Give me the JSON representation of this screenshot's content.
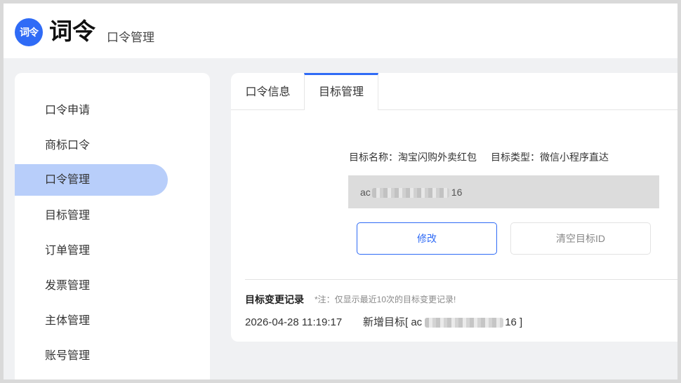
{
  "header": {
    "logo_text": "词令",
    "brand": "词令",
    "subtitle": "口令管理"
  },
  "sidebar": {
    "items": [
      {
        "label": "口令申请",
        "active": false
      },
      {
        "label": "商标口令",
        "active": false
      },
      {
        "label": "口令管理",
        "active": true
      },
      {
        "label": "目标管理",
        "active": false
      },
      {
        "label": "订单管理",
        "active": false
      },
      {
        "label": "发票管理",
        "active": false
      },
      {
        "label": "主体管理",
        "active": false
      },
      {
        "label": "账号管理",
        "active": false
      }
    ]
  },
  "tabs": [
    {
      "label": "口令信息",
      "active": false
    },
    {
      "label": "目标管理",
      "active": true
    }
  ],
  "target": {
    "name_label": "目标名称：",
    "name_value": "淘宝闪购外卖红包",
    "type_label": "目标类型：",
    "type_value": "微信小程序直达",
    "id_prefix": "ac",
    "id_suffix": "16"
  },
  "buttons": {
    "edit": "修改",
    "clear": "清空目标ID"
  },
  "log": {
    "title": "目标变更记录",
    "note": "*注：仅显示最近10次的目标变更记录!",
    "entries": [
      {
        "time": "2026-04-28 11:19:17",
        "action_prefix": "新增目标[ ac",
        "action_suffix": "16 ]"
      }
    ]
  },
  "colors": {
    "accent": "#2f6bf6",
    "active_nav": "#b8cefa",
    "id_box": "#dcdcdc"
  }
}
